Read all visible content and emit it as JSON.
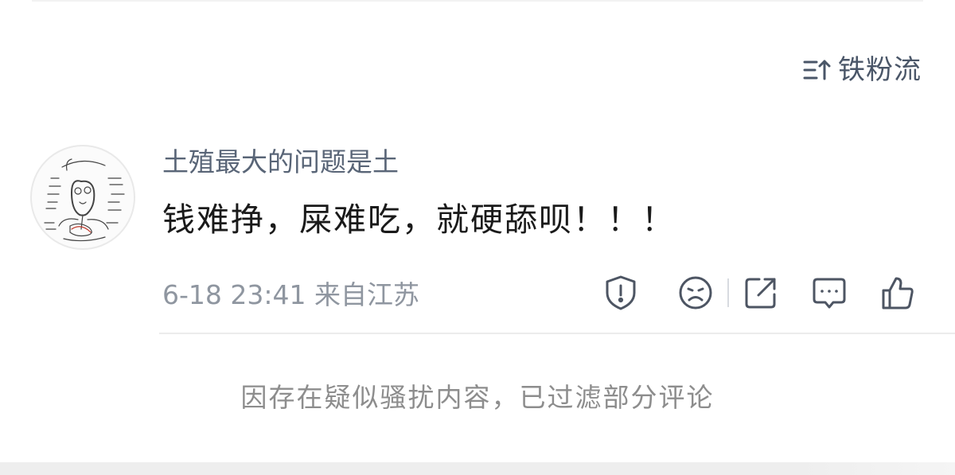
{
  "sort": {
    "label": "铁粉流",
    "icon": "sort-arrow-icon"
  },
  "comment": {
    "username": "土殖最大的问题是土",
    "content": "钱难挣，屎难吃，就硬舔呗！！！",
    "meta": "6-18 23:41 来自江苏",
    "actions": [
      "report-icon",
      "dislike-icon",
      "share-icon",
      "comment-icon",
      "like-icon"
    ]
  },
  "notice": {
    "text": "因存在疑似骚扰内容，已过滤部分评论"
  },
  "colors": {
    "username": "#596577",
    "meta": "#8f96a0",
    "content": "#1a1a1a",
    "notice": "#8d8d8d"
  }
}
